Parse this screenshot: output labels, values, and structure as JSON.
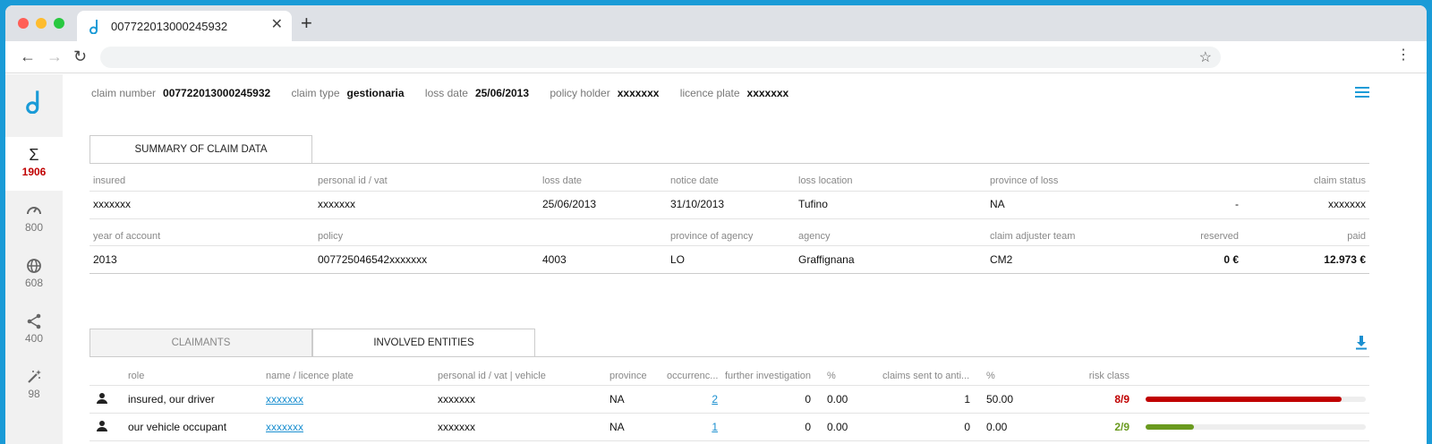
{
  "browser": {
    "tab_title": "007722013000245932",
    "new_tab": "+",
    "close": "✕",
    "back": "←",
    "forward": "→",
    "reload": "↻",
    "star": "☆",
    "menu": "⋮"
  },
  "sidebar": {
    "items": [
      {
        "icon": "sigma-icon",
        "glyph": "Σ",
        "count": "1906"
      },
      {
        "icon": "speedometer-icon",
        "count": "800"
      },
      {
        "icon": "globe-icon",
        "count": "608"
      },
      {
        "icon": "share-icon",
        "count": "400"
      },
      {
        "icon": "magic-wand-icon",
        "count": "98"
      }
    ]
  },
  "header": {
    "claim_number_label": "claim number",
    "claim_number": "007722013000245932",
    "claim_type_label": "claim type",
    "claim_type": "gestionaria",
    "loss_date_label": "loss date",
    "loss_date": "25/06/2013",
    "policy_holder_label": "policy holder",
    "policy_holder": "xxxxxxx",
    "licence_plate_label": "licence plate",
    "licence_plate": "xxxxxxx"
  },
  "summary": {
    "tab_label": "SUMMARY OF CLAIM DATA",
    "row1_headers": [
      "insured",
      "personal id / vat",
      "loss date",
      "notice date",
      "loss location",
      "province of loss",
      "claim status"
    ],
    "row1_values": [
      "xxxxxxx",
      "xxxxxxx",
      "25/06/2013",
      "31/10/2013",
      "Tufino",
      "NA",
      "-",
      "xxxxxxx"
    ],
    "row2_headers": [
      "year of account",
      "policy",
      "province of agency",
      "agency",
      "claim adjuster team",
      "reserved",
      "paid"
    ],
    "row2_values": [
      "2013",
      "007725046542xxxxxxx",
      "4003",
      "LO",
      "Graffignana",
      "CM2",
      "0 €",
      "12.973 €"
    ]
  },
  "entities": {
    "tabs": [
      "CLAIMANTS",
      "INVOLVED ENTITIES"
    ],
    "columns": [
      "role",
      "name / licence plate",
      "personal id / vat | vehicle",
      "province",
      "occurrenc...",
      "further investigation",
      "%",
      "claims sent to anti...",
      "%",
      "risk class"
    ],
    "rows": [
      {
        "role": "insured, our driver",
        "name": "xxxxxxx",
        "id": "xxxxxxx",
        "province": "NA",
        "occurrences": "2",
        "further": "0",
        "pct1": "0.00",
        "sent": "1",
        "pct2": "50.00",
        "risk": "8/9",
        "risk_value": 0.89,
        "risk_color": "#c00000"
      },
      {
        "role": "our vehicle occupant",
        "name": "xxxxxxx",
        "id": "xxxxxxx",
        "province": "NA",
        "occurrences": "1",
        "further": "0",
        "pct1": "0.00",
        "sent": "0",
        "pct2": "0.00",
        "risk": "2/9",
        "risk_value": 0.22,
        "risk_color": "#6a9a1f"
      }
    ]
  },
  "colors": {
    "accent": "#1a9bd7",
    "danger": "#c00000",
    "ok": "#6a9a1f"
  }
}
